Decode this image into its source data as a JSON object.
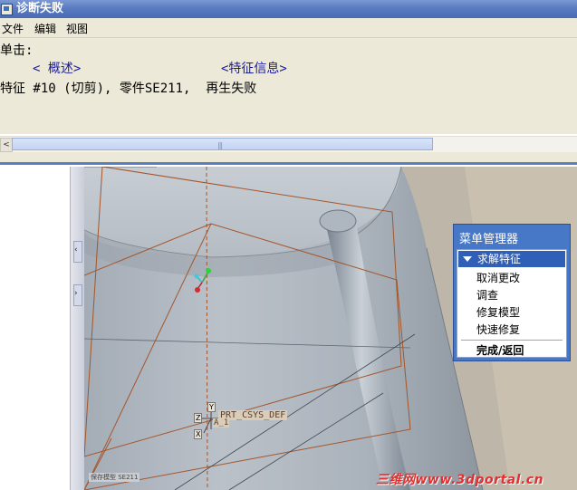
{
  "window": {
    "title": "诊断失败",
    "title_icon": "window-icon"
  },
  "menubar": [
    "文件",
    "编辑",
    "视图"
  ],
  "content": {
    "prompt": "单击:",
    "links": [
      "< 概述>",
      "<特征信息>"
    ],
    "message": "特征 #10 (切剪), 零件SE211,  再生失败"
  },
  "scrollbar": {
    "left_arrow": "<",
    "grip": "|||"
  },
  "model": {
    "csys_label": "PRT_CSYS_DEF",
    "csys_sub": "A_1",
    "axis_marks": [
      "Y",
      "Z",
      "X"
    ],
    "status_label": "保存模型  SE211"
  },
  "menu_manager": {
    "title": "菜单管理器",
    "header": "求解特征",
    "items": [
      "取消更改",
      "调查",
      "修复模型",
      "快速修复"
    ],
    "done": "完成/返回"
  },
  "watermark": "三维网www.3dportal.cn",
  "colors": {
    "title_blue": "#5a7bc0",
    "menu_blue": "#4778c8",
    "link": "#1a1a9c",
    "watermark": "#e23030"
  }
}
